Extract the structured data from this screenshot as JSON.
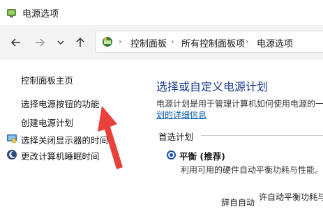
{
  "window": {
    "title": "电源选项"
  },
  "addressbar": {
    "crumbs": [
      "控制面板",
      "所有控制面板项",
      "电源选项"
    ]
  },
  "sidebar": {
    "items": [
      {
        "label": "控制面板主页"
      },
      {
        "label": "选择电源按钮的功能"
      },
      {
        "label": "创建电源计划"
      },
      {
        "label": "选择关闭显示器的时间"
      },
      {
        "label": "更改计算机睡眠时间"
      }
    ]
  },
  "main": {
    "title": "选择或自定义电源计划",
    "description": "电源计划是用于管理计算机如何使用电源的一",
    "description_link": "划的详细信息",
    "group_label": "首选计划",
    "plan": {
      "name": "平衡 (推荐)",
      "description": "利用可用的硬件自动平衡功耗与性能。"
    },
    "clipped_text_1": "许自动平衡功耗与",
    "clipped_text_2": "辞自自动"
  },
  "colors": {
    "accent": "#1b3a8a",
    "link": "#0b5cad",
    "arrow": "#e8403a"
  }
}
